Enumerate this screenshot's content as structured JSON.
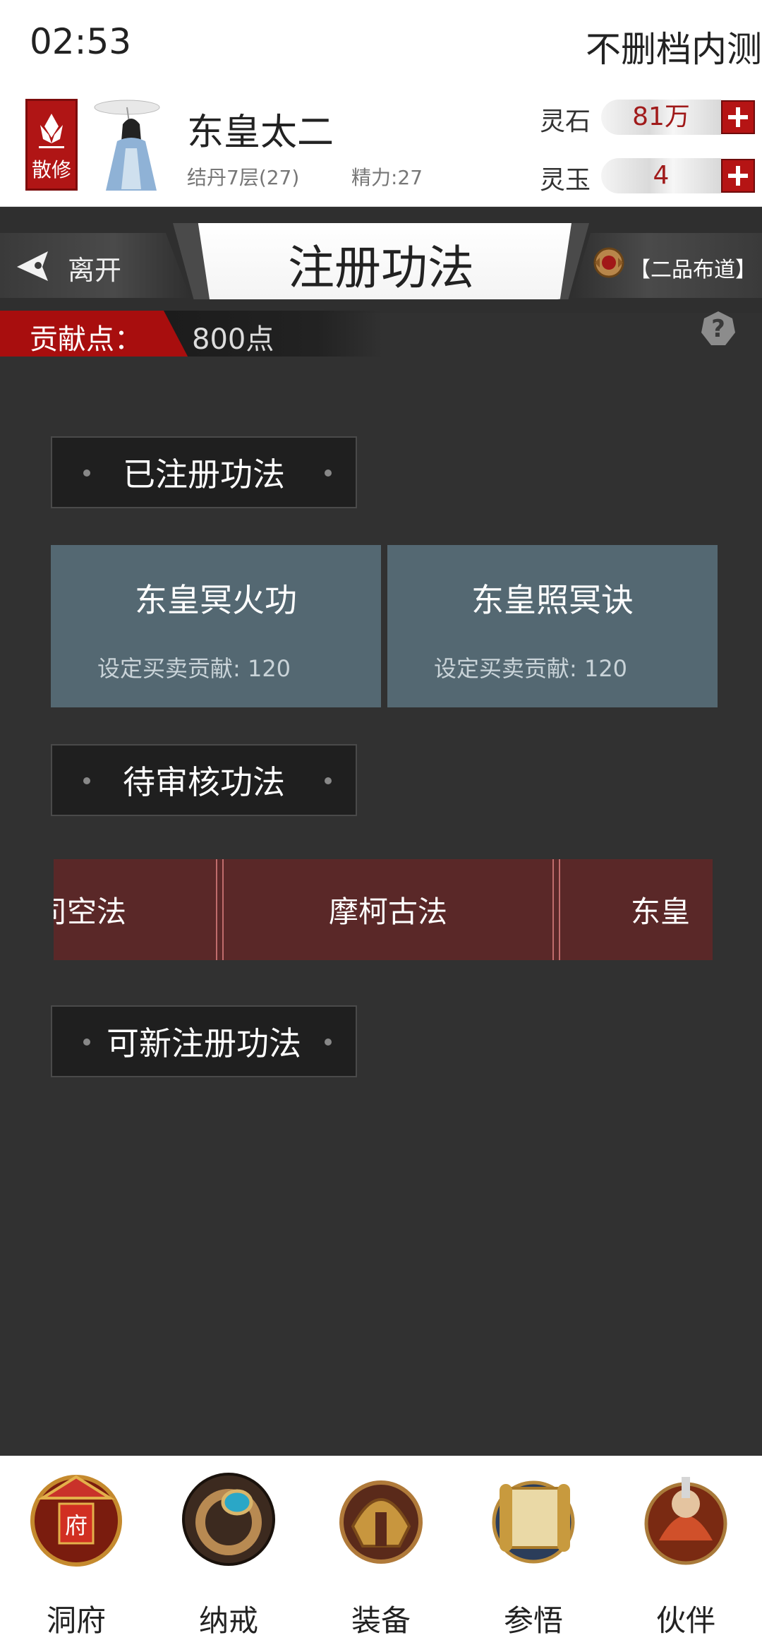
{
  "status_bar": {
    "time": "02:53",
    "server": "不删档内测"
  },
  "player": {
    "sect": "散修",
    "name": "东皇太二",
    "realm": "结丹7层(27)",
    "stamina": "精力:27",
    "resources": [
      {
        "label": "灵石",
        "value": "81万"
      },
      {
        "label": "灵玉",
        "value": "4"
      }
    ]
  },
  "title_bar": {
    "leave": "离开",
    "title": "注册功法",
    "rank": "【二品布道】"
  },
  "contribution": {
    "label": "贡献点：",
    "value": "800点"
  },
  "sections": {
    "registered": {
      "header": "已注册功法",
      "items": [
        {
          "name": "东皇冥火功",
          "price": "设定买卖贡献: 120"
        },
        {
          "name": "东皇照冥诀",
          "price": "设定买卖贡献: 120"
        }
      ]
    },
    "pending": {
      "header": "待审核功法",
      "items": [
        "司空法",
        "摩柯古法",
        "东皇"
      ]
    },
    "new": {
      "header": "可新注册功法"
    }
  },
  "bottom_nav": [
    "洞府",
    "纳戒",
    "装备",
    "参悟",
    "伙伴"
  ],
  "colors": {
    "background": "#313131",
    "accent_red": "#a80e0e",
    "card_blue": "#546872",
    "pending_red": "#5a2828"
  }
}
